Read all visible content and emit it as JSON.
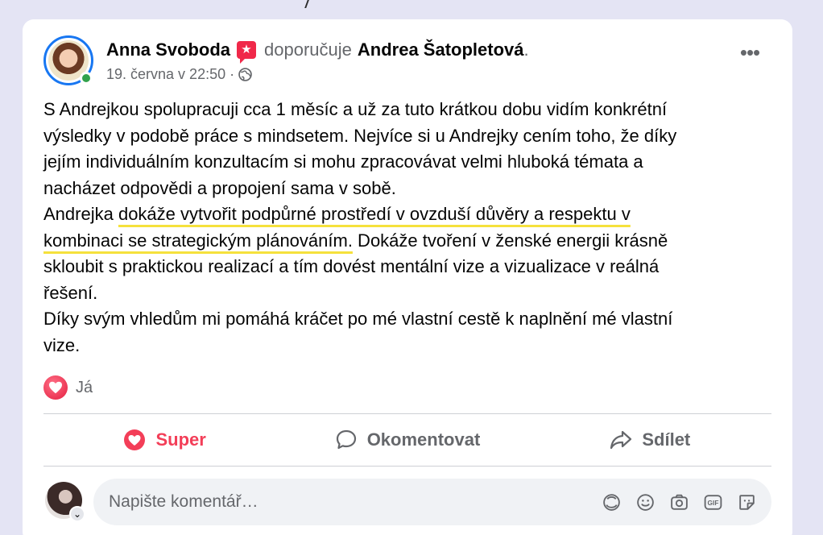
{
  "post": {
    "author": "Anna Svoboda",
    "verb": "doporučuje",
    "target": "Andrea Šatopletová",
    "period": ".",
    "timestamp": "19. června v 22:50 ·",
    "more": "•••",
    "lines": {
      "l1": "S Andrejkou spolupracuji cca 1 měsíc a už za tuto krátkou dobu vidím konkrétní",
      "l2": "výsledky v podobě práce s mindsetem. Nejvíce si u Andrejky cením toho, že díky",
      "l3": "jejím individuálním konzultacím si mohu zpracovávat velmi hluboká témata a",
      "l4": "nacházet odpovědi a propojení sama v sobě.",
      "l5a": "Andrejka ",
      "l5b": "dokáže vytvořit podpůrné prostředí v ovzduší důvěry a respektu v",
      "l6a": "kombinaci se strategickým plánováním.",
      "l6b": " Dokáže tvoření v ženské energii krásně",
      "l7": "skloubit s praktickou realizací a tím dovést mentální vize a vizualizace v reálná",
      "l8": "řešení.",
      "l9": "Díky svým vhledům mi pomáhá kráčet po mé vlastní cestě k naplnění mé vlastní",
      "l10": "vize."
    }
  },
  "reactions": {
    "label": "Já"
  },
  "actions": {
    "super": "Super",
    "comment": "Okomentovat",
    "share": "Sdílet"
  },
  "comment_box": {
    "placeholder": "Napište komentář…",
    "value": ""
  },
  "colors": {
    "accent": "#1877f2",
    "love": "#f33e58",
    "highlight": "#f5e13c",
    "online": "#31a24c"
  },
  "icons": [
    "recommend-badge-icon",
    "globe-icon",
    "more-icon",
    "love-reaction-icon",
    "heart-icon",
    "comment-icon",
    "share-icon",
    "avatar-status-icon",
    "emoji-icon",
    "camera-icon",
    "gif-icon",
    "sticker-icon"
  ]
}
